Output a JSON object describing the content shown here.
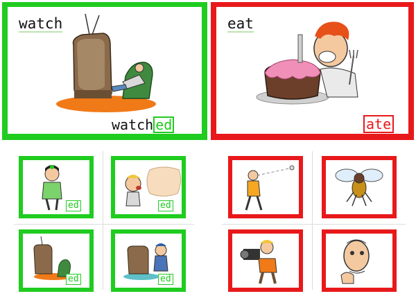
{
  "site_url": "www.marks-english-school.com",
  "cards": {
    "watch": {
      "word": "watch",
      "answer_base": "watch",
      "answer_suffix": "ed",
      "color": "#1fcc1f"
    },
    "eat": {
      "word": "eat",
      "answer_suffix": "ate",
      "color": "#e8191b"
    }
  },
  "small_cards": {
    "girl_hug": {
      "badge": "ed"
    },
    "boy_shout": {
      "badge": "ed"
    },
    "tv_sleep": {
      "badge": "ed"
    },
    "tv_repair": {
      "badge": "ed"
    }
  },
  "colors": {
    "regular": "#1fcc1f",
    "irregular": "#e8191b"
  }
}
